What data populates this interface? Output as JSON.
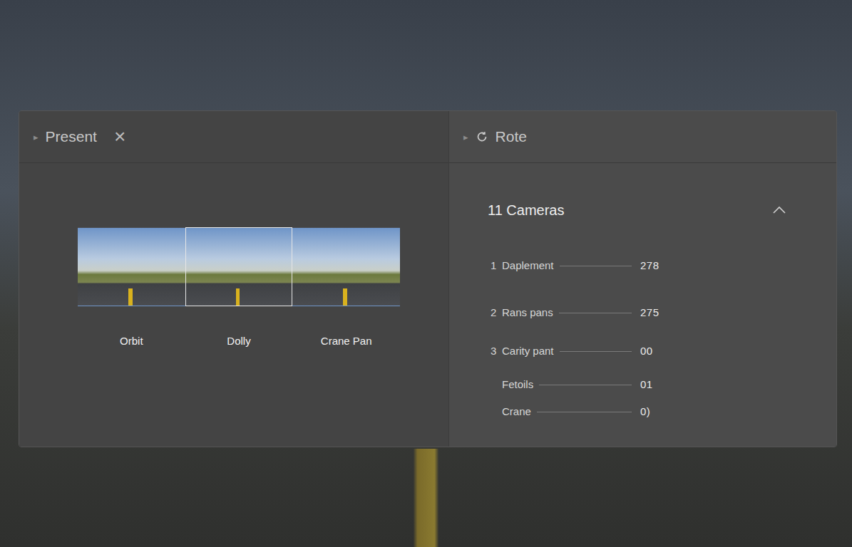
{
  "left_panel": {
    "expander": "▸",
    "title": "Present",
    "close": "×",
    "presets": [
      {
        "label": "Orbit",
        "selected": false
      },
      {
        "label": "Dolly",
        "selected": true
      },
      {
        "label": "Crane Pan",
        "selected": false
      }
    ]
  },
  "right_panel": {
    "expander": "▸",
    "title": "Rote",
    "section": {
      "title": "11 Cameras",
      "expanded": true,
      "rows": [
        {
          "index": "1",
          "label": "Daplement",
          "value": "278"
        },
        {
          "index": "2",
          "label": "Rans pans",
          "value": "275"
        },
        {
          "index": "3",
          "label": "Carity pant",
          "value": "00"
        },
        {
          "index": "",
          "label": "Fetoils",
          "value": "01"
        },
        {
          "index": "",
          "label": "Crane",
          "value": "0)"
        }
      ]
    }
  }
}
